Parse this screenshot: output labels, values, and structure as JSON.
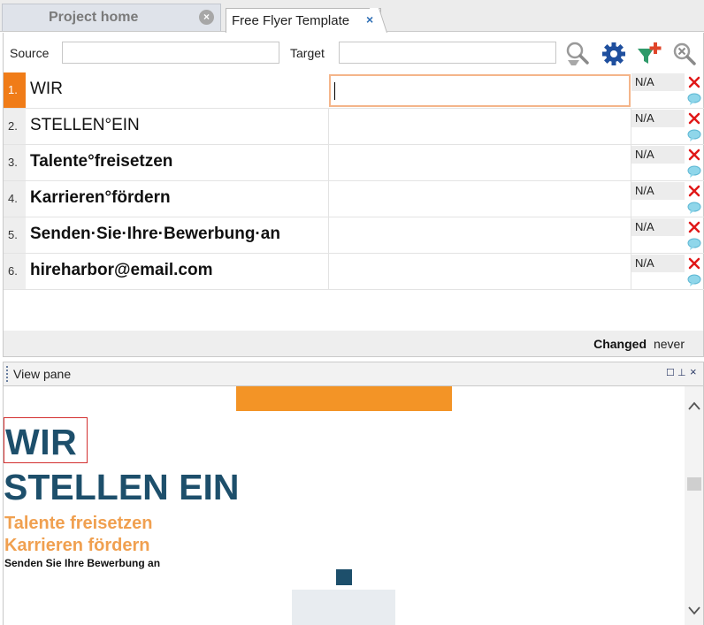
{
  "tabs": [
    {
      "label": "Project home",
      "active": false
    },
    {
      "label": "Free Flyer Template",
      "active": true
    }
  ],
  "filter": {
    "source_label": "Source",
    "source_value": "",
    "target_label": "Target",
    "target_value": ""
  },
  "toolbar_icons": [
    "search-filter-icon",
    "settings-gear-icon",
    "add-filter-icon",
    "clear-search-icon"
  ],
  "segments": [
    {
      "num": "1.",
      "source": "WIR",
      "target": "",
      "status": "N/A",
      "bold": false,
      "active": true
    },
    {
      "num": "2.",
      "source": "STELLEN°EIN",
      "target": "",
      "status": "N/A",
      "bold": false,
      "active": false
    },
    {
      "num": "3.",
      "source": "Talente°freisetzen",
      "target": "",
      "status": "N/A",
      "bold": true,
      "active": false
    },
    {
      "num": "4.",
      "source": "Karrieren°fördern",
      "target": "",
      "status": "N/A",
      "bold": true,
      "active": false
    },
    {
      "num": "5.",
      "source": "Senden·Sie·Ihre·Bewerbung·an",
      "target": "",
      "status": "N/A",
      "bold": true,
      "active": false
    },
    {
      "num": "6.",
      "source": "hireharbor@email.com",
      "target": "",
      "status": "N/A",
      "bold": true,
      "active": false
    }
  ],
  "footer": {
    "changed_label": "Changed",
    "changed_value": "never"
  },
  "view_pane": {
    "title": "View pane",
    "preview": {
      "line1": "WIR",
      "line2": "STELLEN EIN",
      "line3": "Talente freisetzen",
      "line4": "Karrieren fördern",
      "line5": "Senden Sie Ihre Bewerbung an"
    }
  },
  "colors": {
    "accent_orange": "#f07c18",
    "flyer_orange": "#f39426",
    "flyer_blue": "#1d4f6b",
    "flyer_light_orange": "#f0a050"
  }
}
